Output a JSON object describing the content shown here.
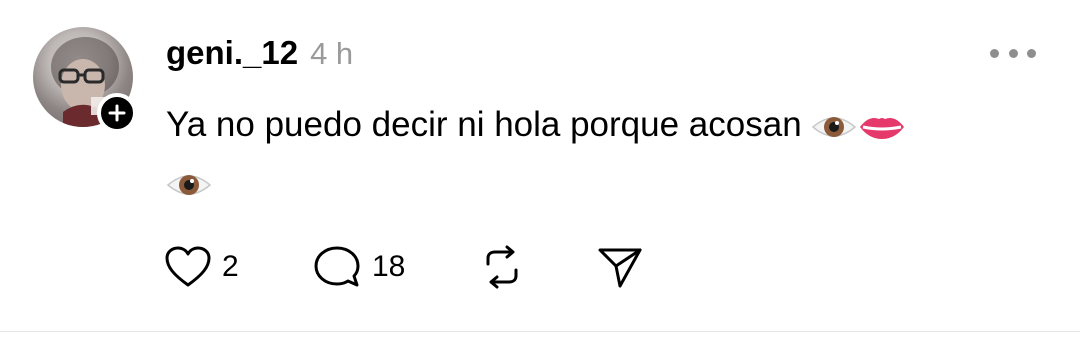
{
  "post": {
    "username": "geni._12",
    "time": "4 h",
    "text_line1": "Ya no puedo decir ni hola porque acosan",
    "emojis": [
      "eye-emoji",
      "lips-emoji",
      "eye-emoji"
    ],
    "likes": "2",
    "replies": "18"
  },
  "icons": {
    "follow": "plus-icon",
    "more": "more-horizontal-icon",
    "like": "heart-icon",
    "reply": "comment-icon",
    "repost": "repost-icon",
    "share": "send-icon"
  },
  "colors": {
    "text": "#000000",
    "muted": "#9a9a9a",
    "divider": "#e6e6e6"
  }
}
